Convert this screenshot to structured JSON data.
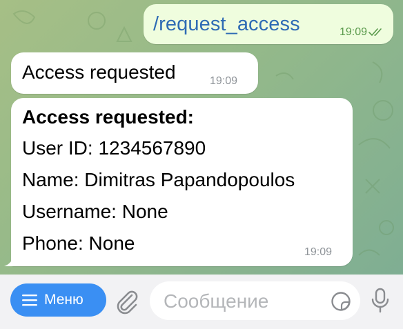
{
  "messages": {
    "outgoing": {
      "text": "/request_access",
      "time": "19:09"
    },
    "incoming_1": {
      "text": "Access requested",
      "time": "19:09"
    },
    "incoming_2": {
      "title": "Access requested:",
      "lines": [
        "User ID: 1234567890",
        "Name: Dimitras Papandopoulos",
        "Username: None",
        "Phone: None"
      ],
      "time": "19:09"
    }
  },
  "input_bar": {
    "menu_label": "Меню",
    "placeholder": "Сообщение"
  },
  "icons": {
    "menu": "hamburger-icon",
    "attach": "paperclip-icon",
    "sticker": "sticker-icon",
    "mic": "microphone-icon",
    "read": "double-check-icon"
  },
  "colors": {
    "accent": "#3a8ff3",
    "outgoing_bubble": "#effdde",
    "link": "#2e6bb4"
  }
}
